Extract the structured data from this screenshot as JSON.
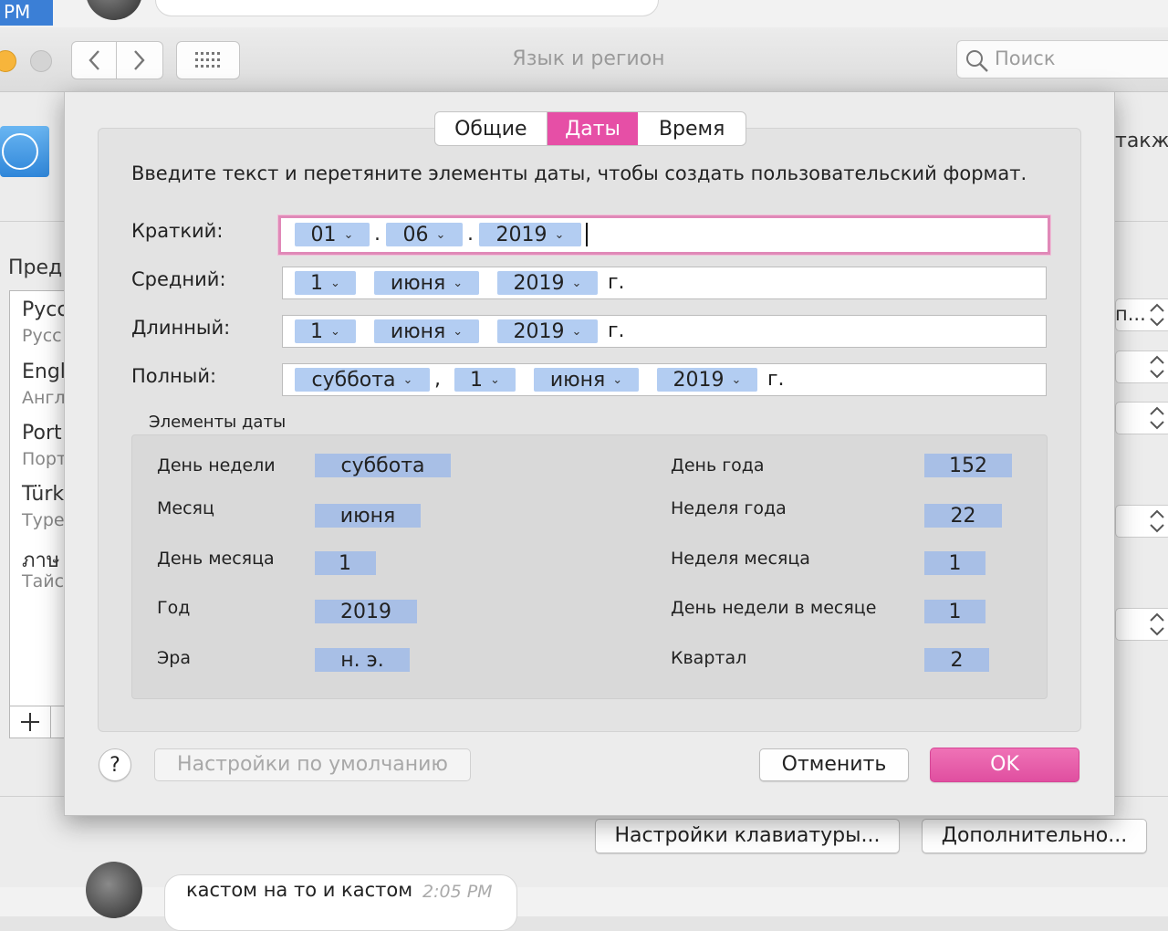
{
  "chat": {
    "top_label": "PM",
    "bottom_message": "кастом на то и кастом",
    "bottom_time": "2:05 PM"
  },
  "window": {
    "title": "Язык и регион",
    "search_placeholder": "Поиск",
    "background_right_text": "также",
    "preferred_label": "Пред",
    "languages": [
      {
        "name": "Русс",
        "sub": "Русс"
      },
      {
        "name": "Engl",
        "sub": "Англ"
      },
      {
        "name": "Port",
        "sub": "Порт"
      },
      {
        "name": "Türk",
        "sub": "Туре"
      },
      {
        "name": "ภาษ",
        "sub": "Тайс"
      }
    ],
    "stepper_first_text": "п...",
    "keyboard_button": "Настройки клавиатуры...",
    "advanced_button": "Дополнительно..."
  },
  "sheet": {
    "tabs": [
      "Общие",
      "Даты",
      "Время"
    ],
    "active_tab": "Даты",
    "instruction": "Введите текст и перетяните элементы даты, чтобы создать пользовательский формат.",
    "formats": {
      "short": {
        "label": "Краткий:",
        "day": "01",
        "sep1": ".",
        "month": "06",
        "sep2": ".",
        "year": "2019"
      },
      "medium": {
        "label": "Средний:",
        "day": "1",
        "month": "июня",
        "year": "2019",
        "suffix": "г."
      },
      "long": {
        "label": "Длинный:",
        "day": "1",
        "month": "июня",
        "year": "2019",
        "suffix": "г."
      },
      "full": {
        "label": "Полный:",
        "weekday": "суббота",
        "comma": ",",
        "day": "1",
        "month": "июня",
        "year": "2019",
        "suffix": "г."
      }
    },
    "elements_title": "Элементы даты",
    "elements_left": [
      {
        "label": "День недели",
        "value": "суббота"
      },
      {
        "label": "Месяц",
        "value": "июня"
      },
      {
        "label": "День месяца",
        "value": "1"
      },
      {
        "label": "Год",
        "value": "2019"
      },
      {
        "label": "Эра",
        "value": "н. э."
      }
    ],
    "elements_right": [
      {
        "label": "День года",
        "value": "152"
      },
      {
        "label": "Неделя года",
        "value": "22"
      },
      {
        "label": "Неделя месяца",
        "value": "1"
      },
      {
        "label": "День недели в месяце",
        "value": "1"
      },
      {
        "label": "Квартал",
        "value": "2"
      }
    ],
    "help": "?",
    "defaults_button": "Настройки по умолчанию",
    "cancel_button": "Отменить",
    "ok_button": "OK"
  },
  "colors": {
    "accent": "#e64fa6",
    "token": "#b3cdf2",
    "element_value": "#a8bfe6"
  }
}
